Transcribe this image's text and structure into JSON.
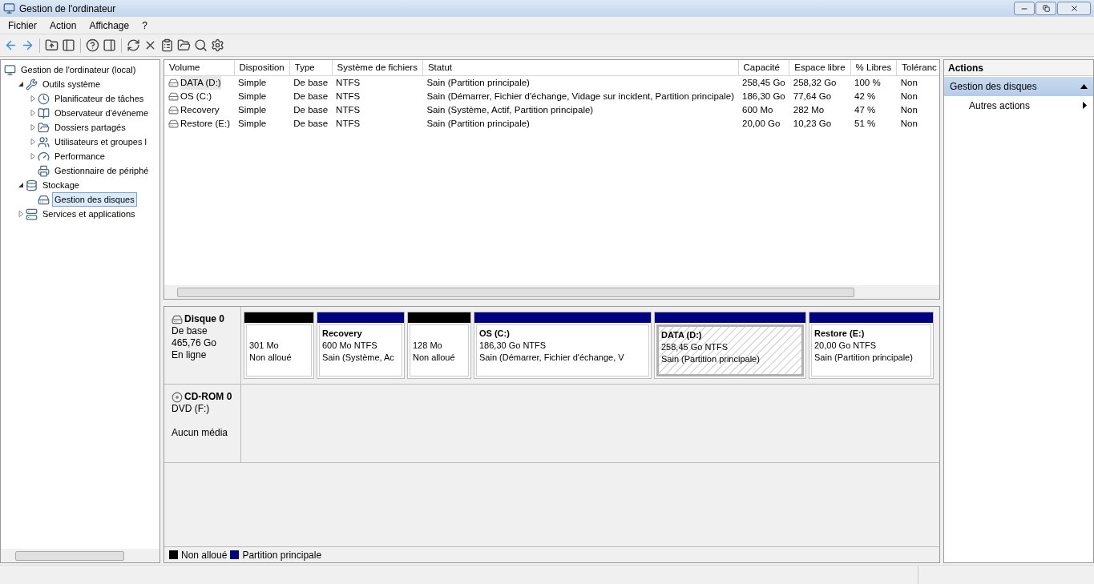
{
  "window": {
    "title": "Gestion de l'ordinateur"
  },
  "menu": [
    "Fichier",
    "Action",
    "Affichage",
    "?"
  ],
  "tree": [
    {
      "label": "Gestion de l'ordinateur (local)",
      "selected": false,
      "children": [
        {
          "label": "Outils système",
          "expanded": true,
          "selected": false,
          "children": [
            {
              "label": "Planificateur de tâches",
              "expanded": false,
              "selected": false
            },
            {
              "label": "Observateur d'événeme",
              "expanded": false,
              "selected": false
            },
            {
              "label": "Dossiers partagés",
              "expanded": false,
              "selected": false
            },
            {
              "label": "Utilisateurs et groupes l",
              "expanded": false,
              "selected": false
            },
            {
              "label": "Performance",
              "expanded": false,
              "selected": false
            },
            {
              "label": "Gestionnaire de périphé",
              "selected": false
            }
          ]
        },
        {
          "label": "Stockage",
          "expanded": true,
          "selected": false,
          "children": [
            {
              "label": "Gestion des disques",
              "selected": true
            }
          ]
        },
        {
          "label": "Services et applications",
          "expanded": false,
          "selected": false
        }
      ]
    }
  ],
  "table": {
    "columns": [
      "Volume",
      "Disposition",
      "Type",
      "Système de fichiers",
      "Statut",
      "Capacité",
      "Espace libre",
      "% Libres",
      "Toléranc"
    ],
    "rows": [
      {
        "selected": true,
        "cells": [
          "DATA (D:)",
          "Simple",
          "De base",
          "NTFS",
          "Sain (Partition principale)",
          "258,45 Go",
          "258,32 Go",
          "100 %",
          "Non"
        ]
      },
      {
        "selected": false,
        "cells": [
          "OS (C:)",
          "Simple",
          "De base",
          "NTFS",
          "Sain (Démarrer, Fichier d'échange, Vidage sur incident, Partition principale)",
          "186,30 Go",
          "77,64 Go",
          "42 %",
          "Non"
        ]
      },
      {
        "selected": false,
        "cells": [
          "Recovery",
          "Simple",
          "De base",
          "NTFS",
          "Sain (Système, Actif, Partition principale)",
          "600 Mo",
          "282 Mo",
          "47 %",
          "Non"
        ]
      },
      {
        "selected": false,
        "cells": [
          "Restore (E:)",
          "Simple",
          "De base",
          "NTFS",
          "Sain (Partition principale)",
          "20,00 Go",
          "10,23 Go",
          "51 %",
          "Non"
        ]
      }
    ]
  },
  "disks": [
    {
      "kind": "disk",
      "name": "Disque 0",
      "lines": [
        "De base",
        "465,76 Go",
        "En ligne"
      ],
      "partitions": [
        {
          "color": "#000000",
          "selected": false,
          "lines": [
            "301 Mo",
            "Non alloué"
          ]
        },
        {
          "color": "#000080",
          "selected": false,
          "title": "Recovery",
          "lines": [
            "600 Mo NTFS",
            "Sain (Système, Ac"
          ]
        },
        {
          "color": "#000000",
          "selected": false,
          "lines": [
            "128 Mo",
            "Non alloué"
          ]
        },
        {
          "color": "#000080",
          "selected": false,
          "title": "OS  (C:)",
          "lines": [
            "186,30 Go NTFS",
            "Sain (Démarrer, Fichier d'échange, V"
          ]
        },
        {
          "color": "#000080",
          "selected": true,
          "title": "DATA  (D:)",
          "lines": [
            "258,45 Go NTFS",
            "Sain (Partition principale)"
          ]
        },
        {
          "color": "#000080",
          "selected": false,
          "title": "Restore  (E:)",
          "lines": [
            "20,00 Go NTFS",
            "Sain (Partition principale)"
          ]
        }
      ]
    },
    {
      "kind": "cdrom",
      "name": "CD-ROM 0",
      "lines": [
        "DVD (F:)",
        "Aucun média"
      ]
    }
  ],
  "legend": [
    {
      "label": "Non alloué",
      "color": "#000000"
    },
    {
      "label": "Partition principale",
      "color": "#000080"
    }
  ],
  "actions": {
    "title": "Actions",
    "groups": [
      {
        "label": "Gestion des disques",
        "expanded": true,
        "items": [
          "Autres actions"
        ]
      }
    ]
  }
}
